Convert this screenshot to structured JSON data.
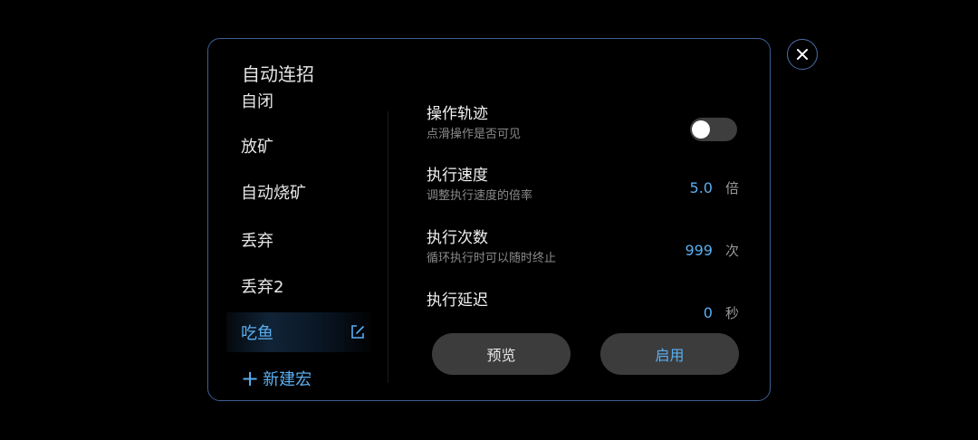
{
  "dialog": {
    "title": "自动连招"
  },
  "menu": {
    "items": [
      {
        "label": "自闭"
      },
      {
        "label": "放矿"
      },
      {
        "label": "自动烧矿"
      },
      {
        "label": "丢弃"
      },
      {
        "label": "丢弃2"
      },
      {
        "label": "吃鱼"
      }
    ],
    "active_index": 5,
    "new_macro_label": "新建宏"
  },
  "settings": {
    "trajectory": {
      "title": "操作轨迹",
      "subtitle": "点滑操作是否可见",
      "enabled": false
    },
    "speed": {
      "title": "执行速度",
      "subtitle": "调整执行速度的倍率",
      "value": "5.0",
      "unit": "倍"
    },
    "count": {
      "title": "执行次数",
      "subtitle": "循环执行时可以随时终止",
      "value": "999",
      "unit": "次"
    },
    "delay": {
      "title": "执行延迟",
      "value": "0",
      "unit": "秒"
    }
  },
  "buttons": {
    "preview": "预览",
    "enable": "启用"
  },
  "colors": {
    "accent": "#5aaef0",
    "border": "#3c5f95",
    "background": "#000000"
  }
}
